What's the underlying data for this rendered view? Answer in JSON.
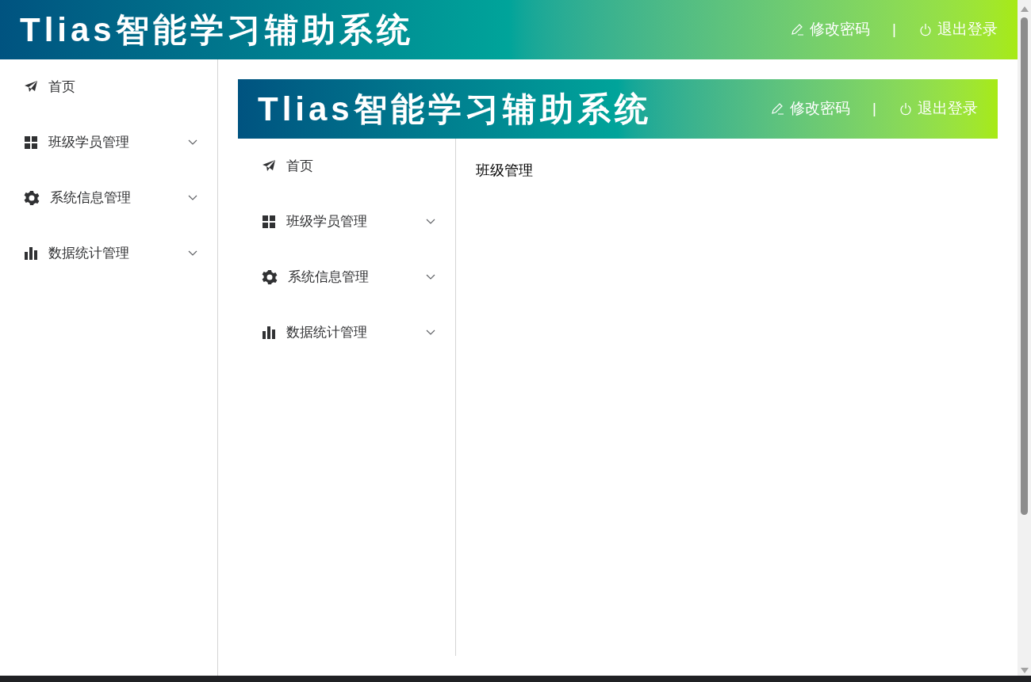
{
  "header": {
    "title": "Tlias智能学习辅助系统",
    "actions": [
      {
        "kind": "edit",
        "label": "修改密码"
      },
      {
        "kind": "logout",
        "label": "退出登录"
      }
    ],
    "separator": "|"
  },
  "sidebar": {
    "items": [
      {
        "kind": "home",
        "label": "首页",
        "has_submenu": false
      },
      {
        "kind": "classes",
        "label": "班级学员管理",
        "has_submenu": true,
        "expanded": false
      },
      {
        "kind": "system",
        "label": "系统信息管理",
        "has_submenu": true,
        "expanded": false
      },
      {
        "kind": "stats",
        "label": "数据统计管理",
        "has_submenu": true,
        "expanded": false
      }
    ]
  },
  "main": {
    "header": {
      "title": "Tlias智能学习辅助系统",
      "actions": [
        {
          "kind": "edit",
          "label": "修改密码"
        },
        {
          "kind": "logout",
          "label": "退出登录"
        }
      ],
      "separator": "|"
    },
    "sidebar": {
      "items": [
        {
          "kind": "home",
          "label": "首页",
          "has_submenu": false
        },
        {
          "kind": "classes",
          "label": "班级学员管理",
          "has_submenu": true,
          "expanded": false
        },
        {
          "kind": "system",
          "label": "系统信息管理",
          "has_submenu": true,
          "expanded": false
        },
        {
          "kind": "stats",
          "label": "数据统计管理",
          "has_submenu": true,
          "expanded": false
        }
      ]
    },
    "content": "班级管理"
  }
}
